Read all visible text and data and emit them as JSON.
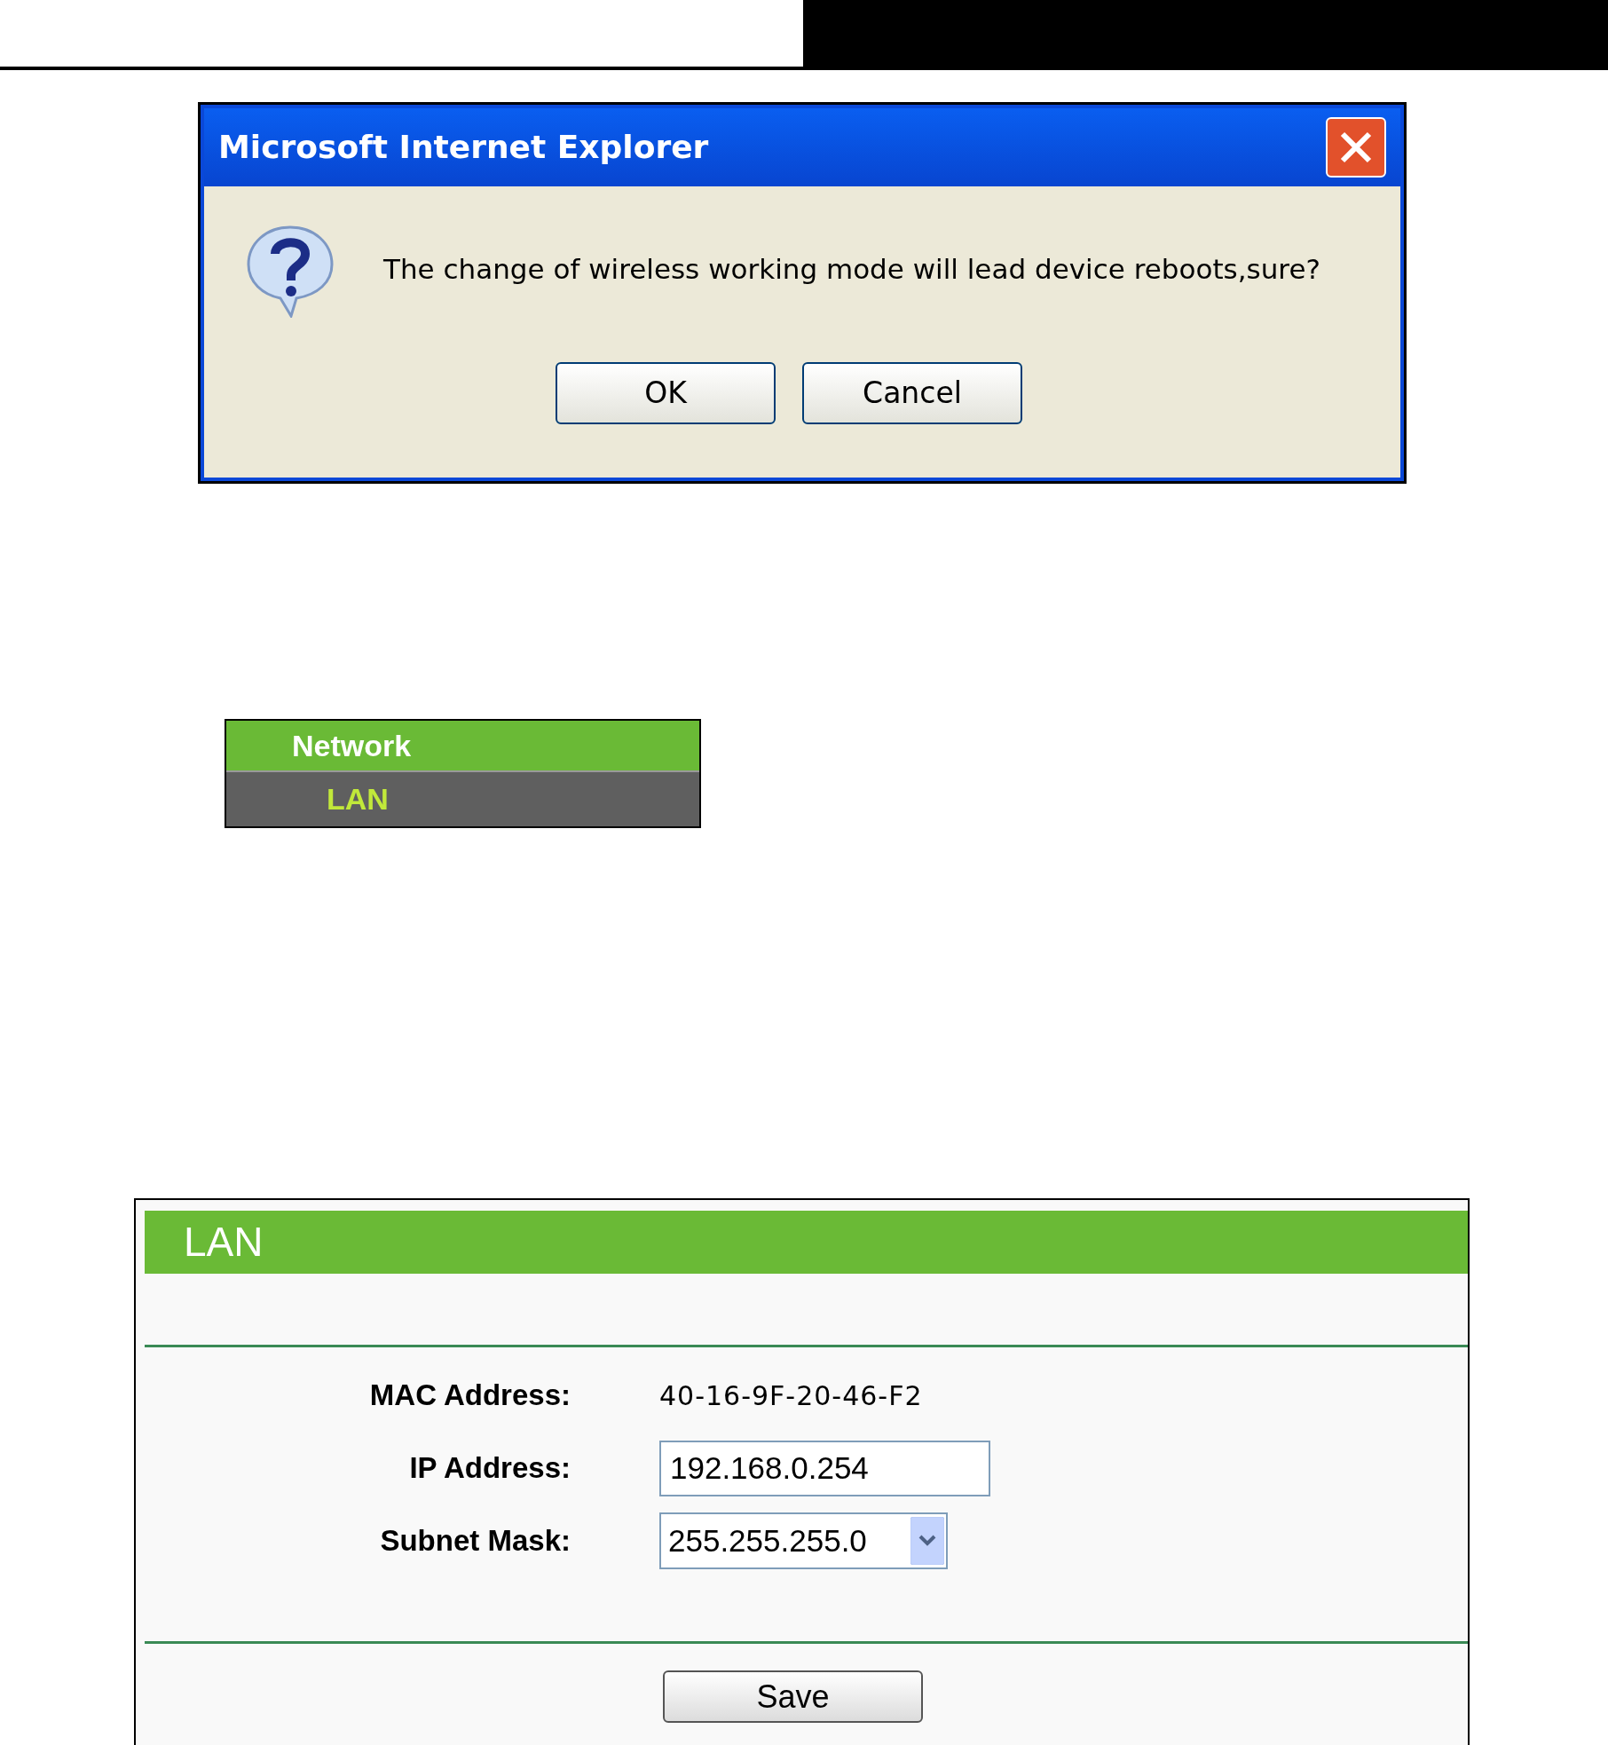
{
  "dialog": {
    "title": "Microsoft Internet Explorer",
    "message": "The change of wireless working mode will lead device reboots,sure?",
    "buttons": [
      "OK",
      "Cancel"
    ]
  },
  "menu": {
    "items": [
      {
        "label": "Network",
        "kind": "header"
      },
      {
        "label": "LAN",
        "kind": "sub"
      }
    ]
  },
  "lan_panel": {
    "title": "LAN",
    "fields": [
      {
        "label": "MAC Address:",
        "kind": "text",
        "value": "40-16-9F-20-46-F2"
      },
      {
        "label": "IP Address:",
        "kind": "input",
        "value": "192.168.0.254"
      },
      {
        "label": "Subnet Mask:",
        "kind": "select",
        "value": "255.255.255.0"
      }
    ],
    "save_button": "Save"
  }
}
